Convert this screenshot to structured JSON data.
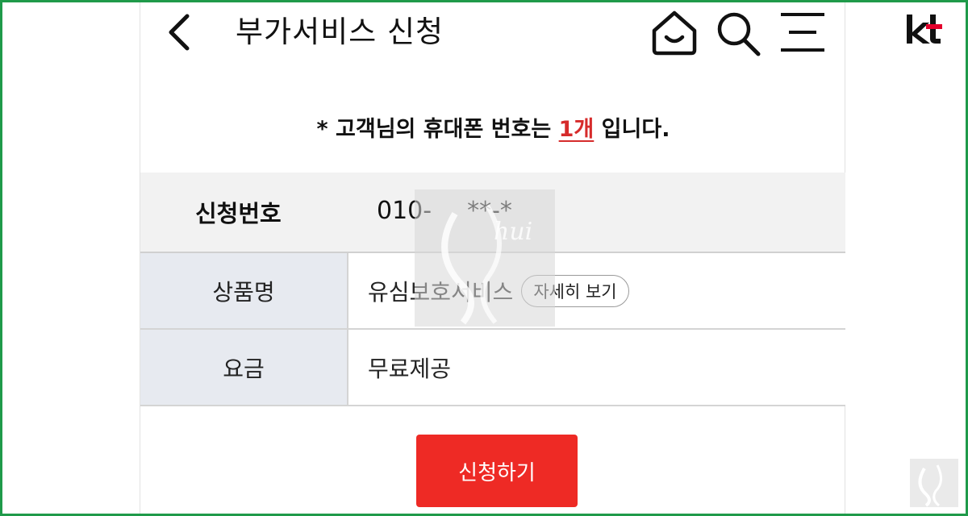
{
  "header": {
    "title": "부가서비스 신청",
    "back_icon": "chevron-left-icon",
    "home_icon": "home-icon",
    "search_icon": "search-icon",
    "menu_icon": "menu-icon"
  },
  "notice": {
    "prefix": "* 고객님의 휴대폰 번호는 ",
    "count": "1개",
    "suffix": " 입니다."
  },
  "phone_number": {
    "label": "신청번호",
    "value": "010-",
    "value_masked": "**-*"
  },
  "product": {
    "label": "상품명",
    "name": "유심보호서비스",
    "detail_button": "자세히 보기"
  },
  "fee": {
    "label": "요금",
    "value": "무료제공"
  },
  "apply_button": "신청하기",
  "brand": {
    "logo": "kt",
    "accent_color": "#ee2a25",
    "frame_color": "#1f9a4a"
  }
}
